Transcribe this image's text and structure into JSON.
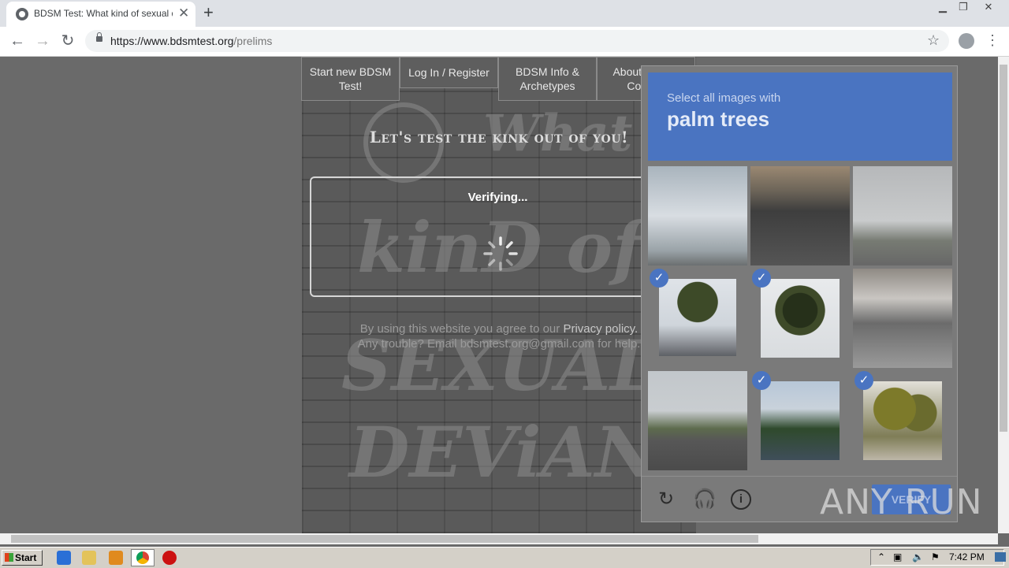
{
  "browser": {
    "tab_title": "BDSM Test: What kind of sexual deviant",
    "url_domain": "https://www.bdsmtest.org",
    "url_path": "/prelims"
  },
  "site_nav": {
    "start_test": "Start new BDSM Test!",
    "login": "Log In / Register",
    "info": "BDSM Info & Archetypes",
    "about": "About / FAQ / Contact"
  },
  "hero": {
    "tagline": "Let's test the kink out of you!",
    "verifying": "Verifying...",
    "graffiti": [
      "What",
      "kinD of",
      "SEXUAL",
      "DEViANT"
    ]
  },
  "footer": {
    "line1_prefix": "By using this website you agree to our",
    "privacy_link": "Privacy policy.",
    "line2": "Any trouble? Email bdsmtest.org@gmail.com for help."
  },
  "captcha": {
    "instruction": "Select all images with",
    "target": "palm trees",
    "verify_label": "VERIFY",
    "tiles": [
      {
        "scene": "sky-clouds",
        "selected": false
      },
      {
        "scene": "highway-dusk",
        "selected": false
      },
      {
        "scene": "overcast-road",
        "selected": false
      },
      {
        "scene": "palm-tree-building",
        "selected": true
      },
      {
        "scene": "palm-tree-closeup",
        "selected": true
      },
      {
        "scene": "bus-street",
        "selected": false
      },
      {
        "scene": "empty-road",
        "selected": false
      },
      {
        "scene": "palms-billboard",
        "selected": true
      },
      {
        "scene": "fan-palms",
        "selected": true
      }
    ],
    "icons": [
      "reload-icon",
      "audio-icon",
      "info-icon"
    ],
    "accent": "#4a74c1"
  },
  "watermark": "ANY RUN",
  "taskbar": {
    "start_label": "Start",
    "time": "7:42 PM"
  }
}
